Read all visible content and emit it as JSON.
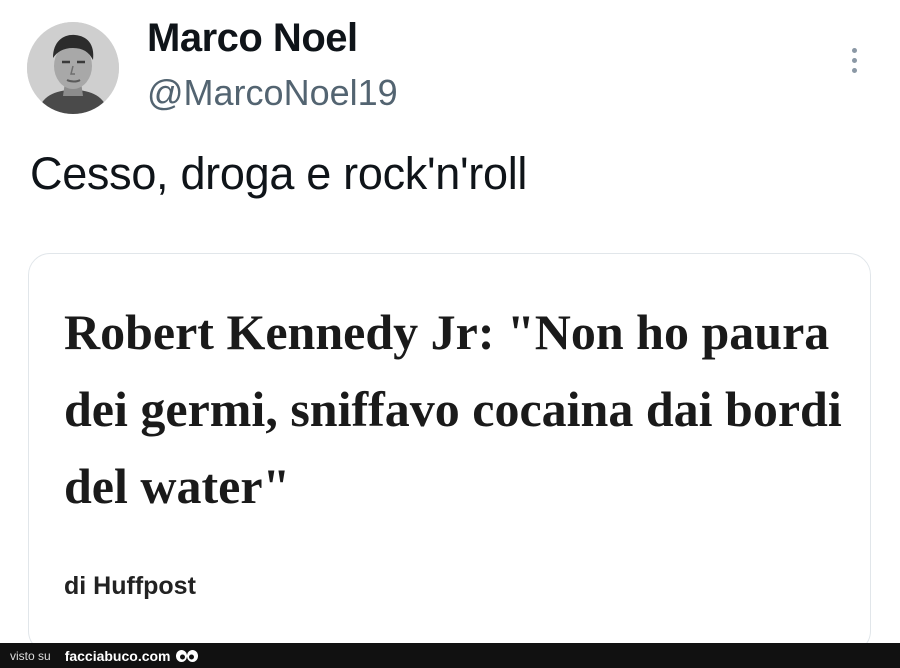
{
  "tweet": {
    "display_name": "Marco Noel",
    "handle": "@MarcoNoel19",
    "text": "Cesso, droga e rock'n'roll",
    "avatar_icon": "profile-photo",
    "more_icon": "more-vertical-icon"
  },
  "card": {
    "headline": "Robert Kennedy Jr: \"Non ho paura dei germi, sniffavo cocaina dai bordi del water\"",
    "source": "di Huffpost"
  },
  "footer": {
    "prefix": "visto su",
    "site": "facciabuco.com",
    "logo_icon": "eyes-icon"
  },
  "colors": {
    "text_primary": "#0f1419",
    "text_secondary": "#536471",
    "card_border": "#e1e6ea",
    "footer_bg": "#111111"
  }
}
